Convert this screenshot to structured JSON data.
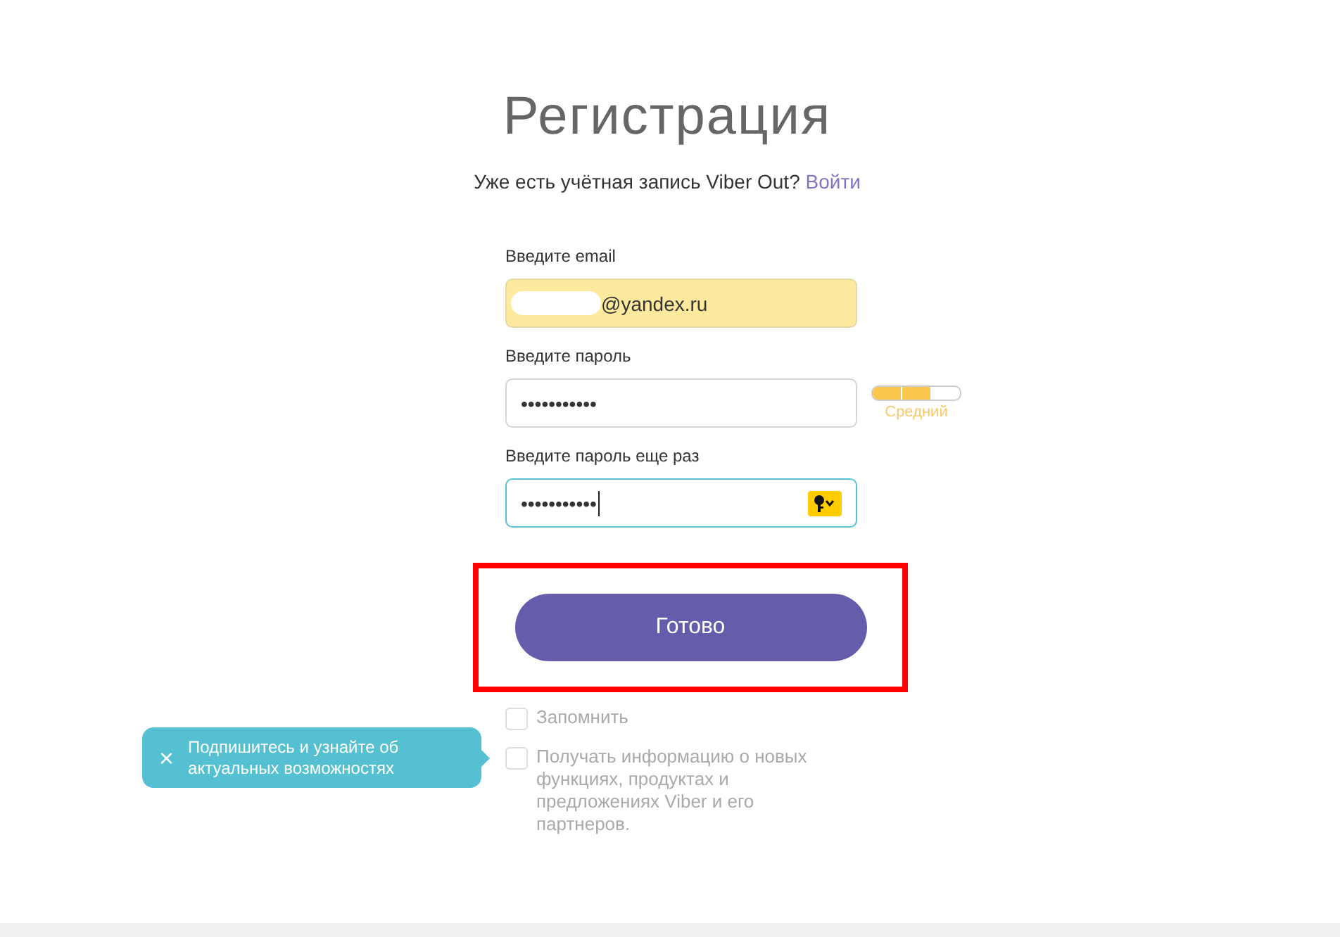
{
  "title": "Регистрация",
  "subtitle": {
    "text": "Уже есть учётная запись Viber Out?",
    "link": "Войти"
  },
  "fields": [
    {
      "kind": "email",
      "label": "Введите email",
      "value": "@yandex.ru",
      "autofilled": true,
      "focused": false
    },
    {
      "kind": "password",
      "label": "Введите пароль",
      "value": "•••••••••••",
      "autofilled": false,
      "focused": false,
      "strength": {
        "level": 0.67,
        "reading": "Средний"
      }
    },
    {
      "kind": "password",
      "label": "Введите пароль еще раз",
      "value": "•••••••••••",
      "autofilled": false,
      "focused": true,
      "key_button": true
    }
  ],
  "submit": {
    "label": "Готово",
    "highlighted": true
  },
  "checkboxes": [
    {
      "label": "Запомнить",
      "checked": false
    },
    {
      "label": "Получать информацию о новых функциях, продуктах и предложениях Viber и его партнеров.",
      "checked": false
    }
  ],
  "tooltip": {
    "close": "×",
    "text": "Подпишитесь и узнайте об актуальных возможностях"
  }
}
